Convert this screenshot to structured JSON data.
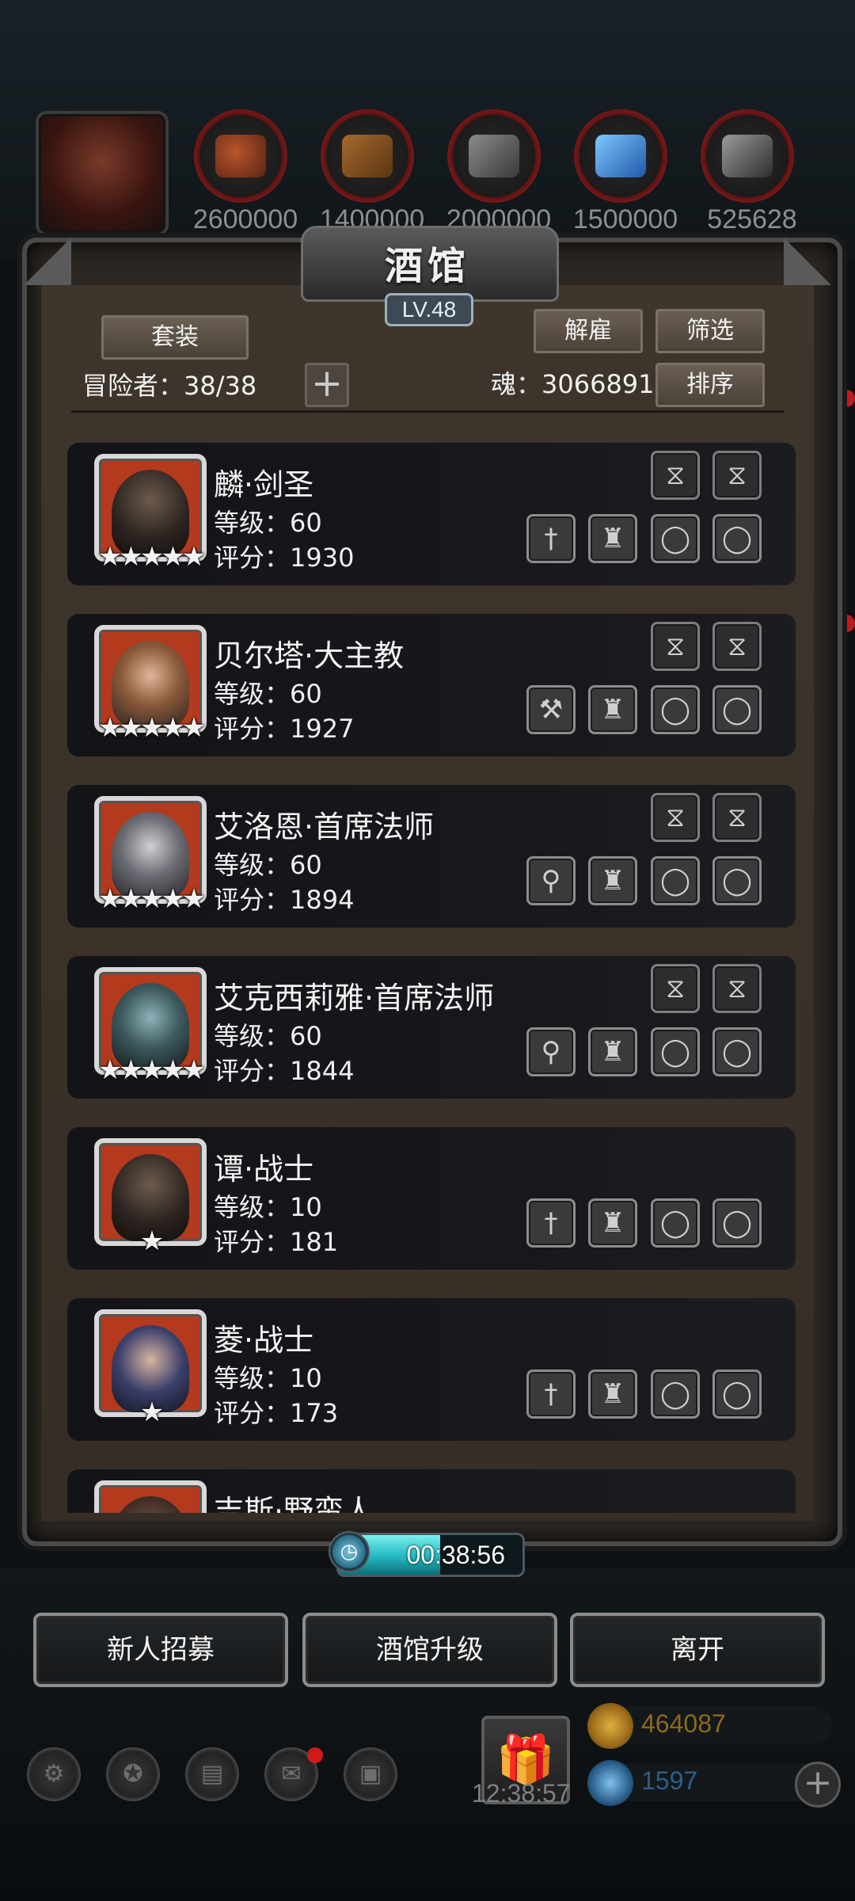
{
  "top_bar": {
    "resources": [
      {
        "icon": "meat-icon",
        "value": "2600000"
      },
      {
        "icon": "wood-icon",
        "value": "1400000"
      },
      {
        "icon": "stone-icon",
        "value": "2000000"
      },
      {
        "icon": "crystal-icon",
        "value": "1500000"
      },
      {
        "icon": "iron-icon",
        "value": "525628"
      }
    ]
  },
  "panel": {
    "title": "酒馆",
    "level": "LV.48",
    "set_button": "套装",
    "dismiss_button": "解雇",
    "filter_button": "筛选",
    "sort_button": "排序",
    "adventurers_label": "冒险者：38/38",
    "soul_label": "魂：3066891",
    "plus_symbol": "+"
  },
  "heroes": [
    {
      "name": "麟·剑圣",
      "level": "等级：60",
      "score": "评分：1930",
      "stars": "★★★★★",
      "weapon": "sword-icon"
    },
    {
      "name": "贝尔塔·大主教",
      "level": "等级：60",
      "score": "评分：1927",
      "stars": "★★★★★",
      "weapon": "hammer-icon"
    },
    {
      "name": "艾洛恩·首席法师",
      "level": "等级：60",
      "score": "评分：1894",
      "stars": "★★★★★",
      "weapon": "staff-icon"
    },
    {
      "name": "艾克西莉雅·首席法师",
      "level": "等级：60",
      "score": "评分：1844",
      "stars": "★★★★★",
      "weapon": "staff-icon"
    },
    {
      "name": "谭·战士",
      "level": "等级：10",
      "score": "评分：181",
      "stars": "★",
      "weapon": "sword-icon"
    },
    {
      "name": "菱·战士",
      "level": "等级：10",
      "score": "评分：173",
      "stars": "★",
      "weapon": "sword-icon"
    },
    {
      "name": "吉斯·野蛮人",
      "level": "",
      "score": "",
      "stars": "",
      "weapon": ""
    }
  ],
  "timer": {
    "text": "00:38:56",
    "progress": 0.55
  },
  "buttons": {
    "recruit": "新人招募",
    "upgrade": "酒馆升级",
    "leave": "离开"
  },
  "hud": {
    "clock": "12:38:57",
    "gold": "464087",
    "gems": "1597"
  },
  "colors": {
    "gold_text": "#8a6a1c",
    "gem_text": "#2a5f8a",
    "timer_fill": "#23b7c2",
    "hero_frame": "#b43a1d"
  }
}
